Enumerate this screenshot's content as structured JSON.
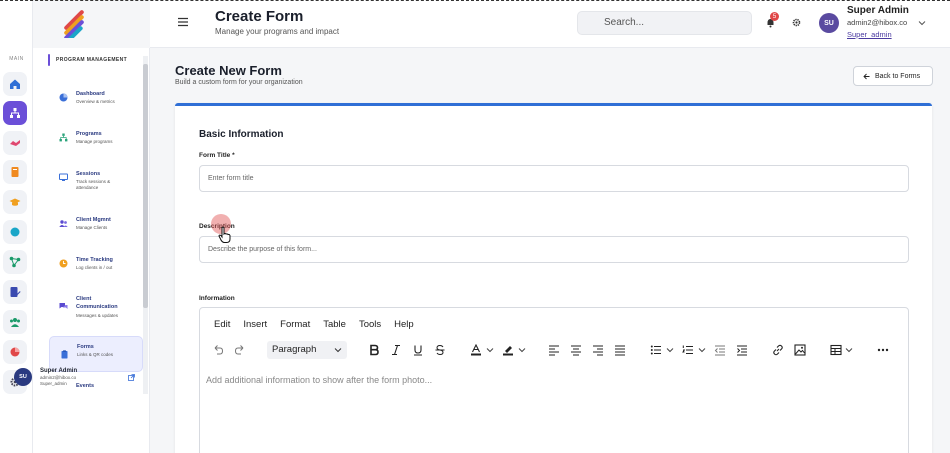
{
  "rail": {
    "main_label": "MAIN"
  },
  "sidebar": {
    "section": "PROGRAM MANAGEMENT",
    "items": [
      {
        "title": "Dashboard",
        "sub": "Overview & metrics",
        "icon": "pie-icon",
        "color": "#3a6fd8"
      },
      {
        "title": "Programs",
        "sub": "Manage programs",
        "icon": "hierarchy-icon",
        "color": "#2aa37a"
      },
      {
        "title": "Sessions",
        "sub": "Track sessions & attendance",
        "icon": "monitor-icon",
        "color": "#3a6fd8"
      },
      {
        "title": "Client Mgmnt",
        "sub": "Manage Clients",
        "icon": "users-icon",
        "color": "#5a4ad0"
      },
      {
        "title": "Time Tracking",
        "sub": "Log clients in / out",
        "icon": "clock-icon",
        "color": "#f0a020"
      },
      {
        "title": "Client Communication",
        "sub": "Messages & updates",
        "icon": "chat-icon",
        "color": "#5a4ad0"
      },
      {
        "title": "Forms",
        "sub": "Links & QR codes",
        "icon": "clipboard-icon",
        "color": "#3a6fd8"
      },
      {
        "title": "Events",
        "sub": "",
        "icon": "",
        "color": ""
      }
    ],
    "user": {
      "name": "Super Admin",
      "email": "admin2@hibox.co",
      "role": "Super_admin",
      "initials": "SU"
    }
  },
  "header": {
    "title": "Create Form",
    "subtitle": "Manage your programs and impact",
    "search_placeholder": "Search...",
    "notifications": "5",
    "user": {
      "name": "Super Admin",
      "email": "admin2@hibox.co",
      "role": "Super_admin",
      "initials": "SU"
    }
  },
  "main": {
    "title": "Create New Form",
    "subtitle": "Build a custom form for your organization",
    "back_label": "Back to Forms"
  },
  "form": {
    "section_title": "Basic Information",
    "title_label": "Form Title *",
    "title_placeholder": "Enter form title",
    "description_label": "Description",
    "description_placeholder": "Describe the purpose of this form...",
    "information_label": "Information",
    "editor": {
      "menu": [
        "Edit",
        "Insert",
        "Format",
        "Table",
        "Tools",
        "Help"
      ],
      "format_value": "Paragraph",
      "placeholder": "Add additional information to show after the form photo..."
    }
  },
  "colors": {
    "accent": "#6b4fd8",
    "primary": "#2f6fd6",
    "danger": "#e04848"
  }
}
